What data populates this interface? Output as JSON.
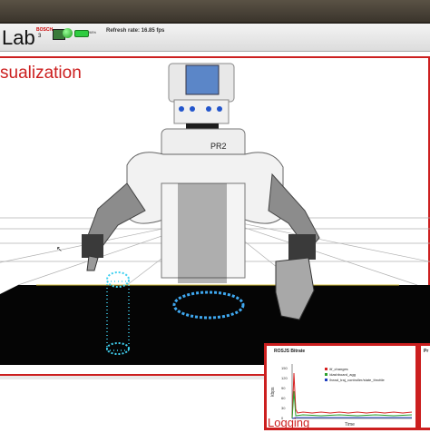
{
  "header": {
    "logo_text": "Lab",
    "logo_sub_top": "BOSCH",
    "logo_sub_bottom": "3",
    "battery_percent": "98%",
    "refresh_label": "Refresh rate: 16.85 fps"
  },
  "visualization": {
    "title": "sualization",
    "robot_label": "PR2"
  },
  "bitrate_panel": {
    "title": "ROSJS Bitrate",
    "title2": "Pr",
    "legend": [
      "/tf_changes",
      "/dashboard_agg",
      "/head_traj_controller/state_throttle"
    ],
    "legend_colors": [
      "#d62020",
      "#2ca02c",
      "#1f3fbf"
    ],
    "ylabel": "kbps",
    "xlabel": "Time",
    "yticks": [
      "150",
      "120",
      "90",
      "60",
      "30",
      "0"
    ]
  },
  "logging_label": "Logging",
  "colors": {
    "accent": "#cc1f1f",
    "pointcloud": "#3fd0f0",
    "floor": "#050505"
  }
}
